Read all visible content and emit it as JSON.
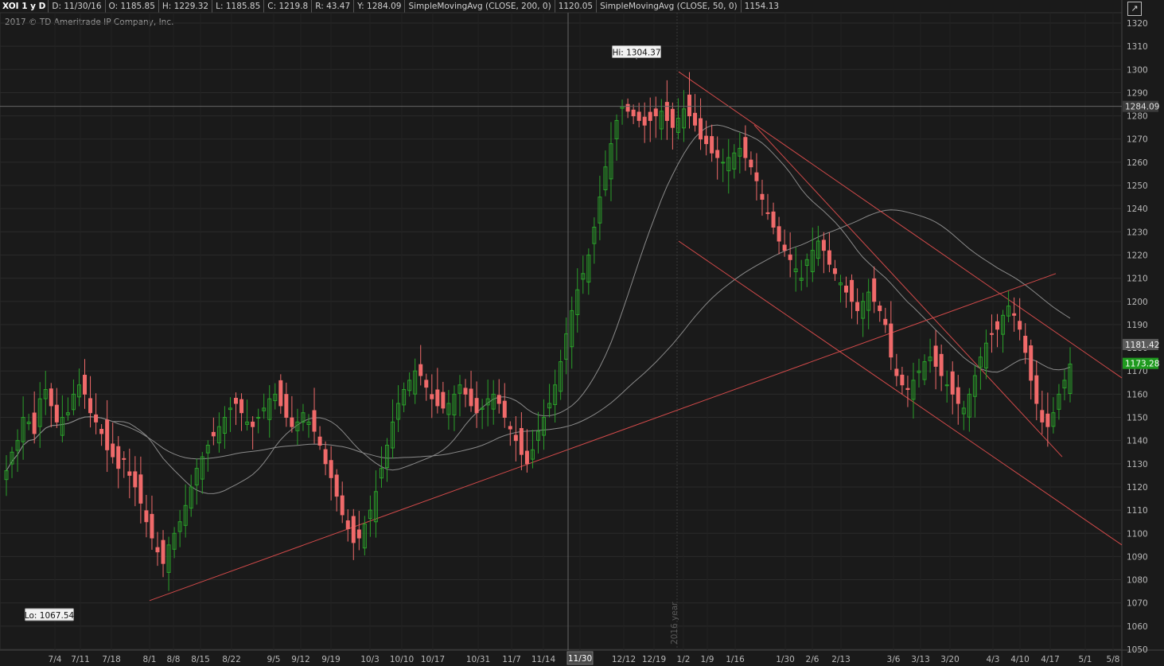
{
  "header": {
    "symbol": "XOI 1 y D",
    "date": "D: 11/30/16",
    "open": "O: 1185.85",
    "high": "H: 1229.32",
    "low": "L: 1185.85",
    "close": "C: 1219.8",
    "range": "R: 43.47",
    "y": "Y: 1284.09",
    "sma200": "SimpleMovingAvg (CLOSE, 200, 0)",
    "sma200_value": "1120.05",
    "sma50": "SimpleMovingAvg (CLOSE, 50, 0)",
    "sma50_value": "1154.13"
  },
  "copyright": "2017 © TD Ameritrade IP Company, Inc.",
  "colors": {
    "up": "#2aa02a",
    "down": "#f06a6a",
    "trendline": "#d24a4a",
    "sma": "#8a8a8a",
    "grid": "#2a2a2a",
    "background": "#1a1a1a"
  },
  "chart_data": {
    "type": "candlestick",
    "ylim": [
      1050,
      1320
    ],
    "y_ticks": [
      "1320",
      "1310",
      "1300",
      "1290",
      "1280",
      "1270",
      "1260",
      "1250",
      "1240",
      "1230",
      "1220",
      "1210",
      "1200",
      "1190",
      "1180",
      "1170",
      "1160",
      "1150",
      "1140",
      "1130",
      "1120",
      "1110",
      "1100",
      "1090",
      "1080",
      "1070",
      "1060",
      "1050"
    ],
    "x_labels": [
      "7/4",
      "7/11",
      "7/18",
      "8/1",
      "8/8",
      "8/15",
      "8/22",
      "9/5",
      "9/12",
      "9/19",
      "10/3",
      "10/10",
      "10/17",
      "10/31",
      "11/7",
      "11/14",
      "11/30",
      "12/12",
      "12/19",
      "1/2",
      "1/9",
      "1/16",
      "1/30",
      "2/6",
      "2/13",
      "3/6",
      "3/13",
      "3/20",
      "4/3",
      "4/10",
      "4/17",
      "5/1",
      "5/8"
    ],
    "cursor_label": "11/30",
    "year_marker": "2016 year",
    "hi_label": "Hi: 1304.37",
    "lo_label": "Lo: 1067.54",
    "price_labels": {
      "crosshair": "1284.09",
      "sma": "1181.42",
      "last": "1173.28"
    },
    "close_series": [
      1127,
      1135,
      1140,
      1150,
      1148,
      1143,
      1158,
      1162,
      1155,
      1148,
      1150,
      1152,
      1160,
      1164,
      1160,
      1152,
      1148,
      1143,
      1136,
      1133,
      1128,
      1132,
      1125,
      1120,
      1113,
      1105,
      1098,
      1092,
      1087,
      1095,
      1100,
      1105,
      1112,
      1120,
      1128,
      1133,
      1138,
      1142,
      1146,
      1150,
      1154,
      1156,
      1152,
      1148,
      1146,
      1150,
      1154,
      1158,
      1160,
      1155,
      1150,
      1146,
      1148,
      1152,
      1148,
      1144,
      1138,
      1130,
      1124,
      1116,
      1108,
      1102,
      1096,
      1098,
      1104,
      1110,
      1118,
      1128,
      1138,
      1148,
      1156,
      1162,
      1166,
      1170,
      1168,
      1163,
      1158,
      1155,
      1154,
      1156,
      1160,
      1164,
      1160,
      1155,
      1152,
      1154,
      1158,
      1160,
      1156,
      1150,
      1145,
      1140,
      1134,
      1130,
      1136,
      1144,
      1150,
      1156,
      1164,
      1174,
      1186,
      1196,
      1205,
      1212,
      1220,
      1232,
      1245,
      1258,
      1268,
      1278,
      1284,
      1282,
      1280,
      1278,
      1276,
      1278,
      1280,
      1282,
      1278,
      1275,
      1279,
      1283,
      1280,
      1276,
      1270,
      1268,
      1264,
      1262,
      1260,
      1262,
      1264,
      1266,
      1262,
      1258,
      1252,
      1244,
      1238,
      1232,
      1226,
      1222,
      1218,
      1214,
      1210,
      1218,
      1222,
      1226,
      1222,
      1216,
      1212,
      1208,
      1204,
      1200,
      1196,
      1200,
      1204,
      1200,
      1196,
      1190,
      1176,
      1168,
      1164,
      1162,
      1166,
      1170,
      1174,
      1176,
      1172,
      1168,
      1164,
      1160,
      1156,
      1154,
      1160,
      1168,
      1176,
      1182,
      1186,
      1188,
      1194,
      1198,
      1194,
      1188,
      1178,
      1166,
      1156,
      1148,
      1146,
      1152,
      1160,
      1166,
      1173
    ]
  }
}
